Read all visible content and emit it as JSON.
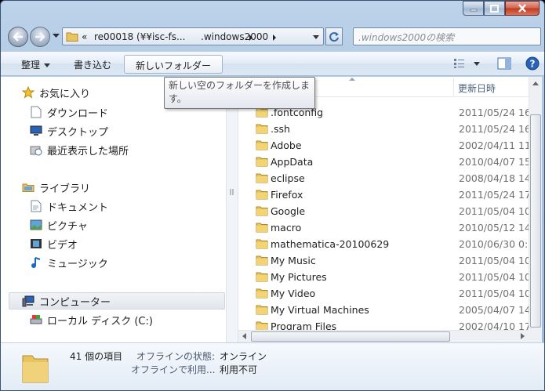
{
  "window": {
    "controls": [
      "minimize",
      "maximize",
      "close"
    ]
  },
  "address": {
    "overflow": "«",
    "segments": [
      "re00018 (¥¥isc-fs...",
      ".windows2000"
    ]
  },
  "search": {
    "placeholder": ".windows2000の検索"
  },
  "toolbar": {
    "organize_label": "整理",
    "burn_label": "書き込む",
    "new_folder_label": "新しいフォルダー"
  },
  "tooltip": {
    "text": "新しい空のフォルダーを作成します。"
  },
  "nav": {
    "favorites": {
      "label": "お気に入り",
      "icon": "star-icon"
    },
    "favorite_items": [
      {
        "label": "ダウンロード",
        "icon": "downloads-icon"
      },
      {
        "label": "デスクトップ",
        "icon": "desktop-icon"
      },
      {
        "label": "最近表示した場所",
        "icon": "recent-places-icon"
      }
    ],
    "libraries": {
      "label": "ライブラリ",
      "icon": "library-icon"
    },
    "library_items": [
      {
        "label": "ドキュメント",
        "icon": "documents-icon"
      },
      {
        "label": "ピクチャ",
        "icon": "pictures-icon"
      },
      {
        "label": "ビデオ",
        "icon": "video-icon"
      },
      {
        "label": "ミュージック",
        "icon": "music-icon"
      }
    ],
    "computer": {
      "label": "コンピューター",
      "icon": "computer-icon"
    },
    "computer_items": [
      {
        "label": "ローカル ディスク (C:)",
        "icon": "local-disk-icon"
      }
    ]
  },
  "list": {
    "columns": {
      "date": "更新日時"
    },
    "rows": [
      {
        "name": ".fontconfig",
        "date": "2011/05/24 16"
      },
      {
        "name": ".ssh",
        "date": "2011/05/24 16"
      },
      {
        "name": "Adobe",
        "date": "2002/04/11 11"
      },
      {
        "name": "AppData",
        "date": "2010/04/07 15"
      },
      {
        "name": "eclipse",
        "date": "2008/04/18 14"
      },
      {
        "name": "Firefox",
        "date": "2011/05/24 17"
      },
      {
        "name": "Google",
        "date": "2011/05/04 10"
      },
      {
        "name": "macro",
        "date": "2010/05/12 14"
      },
      {
        "name": "mathematica-20100629",
        "date": "2010/06/30 0:1"
      },
      {
        "name": "My Music",
        "date": "2011/05/04 10"
      },
      {
        "name": "My Pictures",
        "date": "2011/05/04 10"
      },
      {
        "name": "My Video",
        "date": "2011/05/04 10"
      },
      {
        "name": "My Virtual Machines",
        "date": "2005/04/07 14"
      },
      {
        "name": "Program Files",
        "date": "2002/04/10 17"
      }
    ]
  },
  "details": {
    "item_count": "41 個の項目",
    "offline_status_label": "オフラインの状態:",
    "offline_status_value": "オンライン",
    "offline_avail_label": "オフラインで利用...",
    "offline_avail_value": "利用不可"
  },
  "colors": {
    "folder": "#e8c560",
    "accent": "#3b6fb6"
  }
}
